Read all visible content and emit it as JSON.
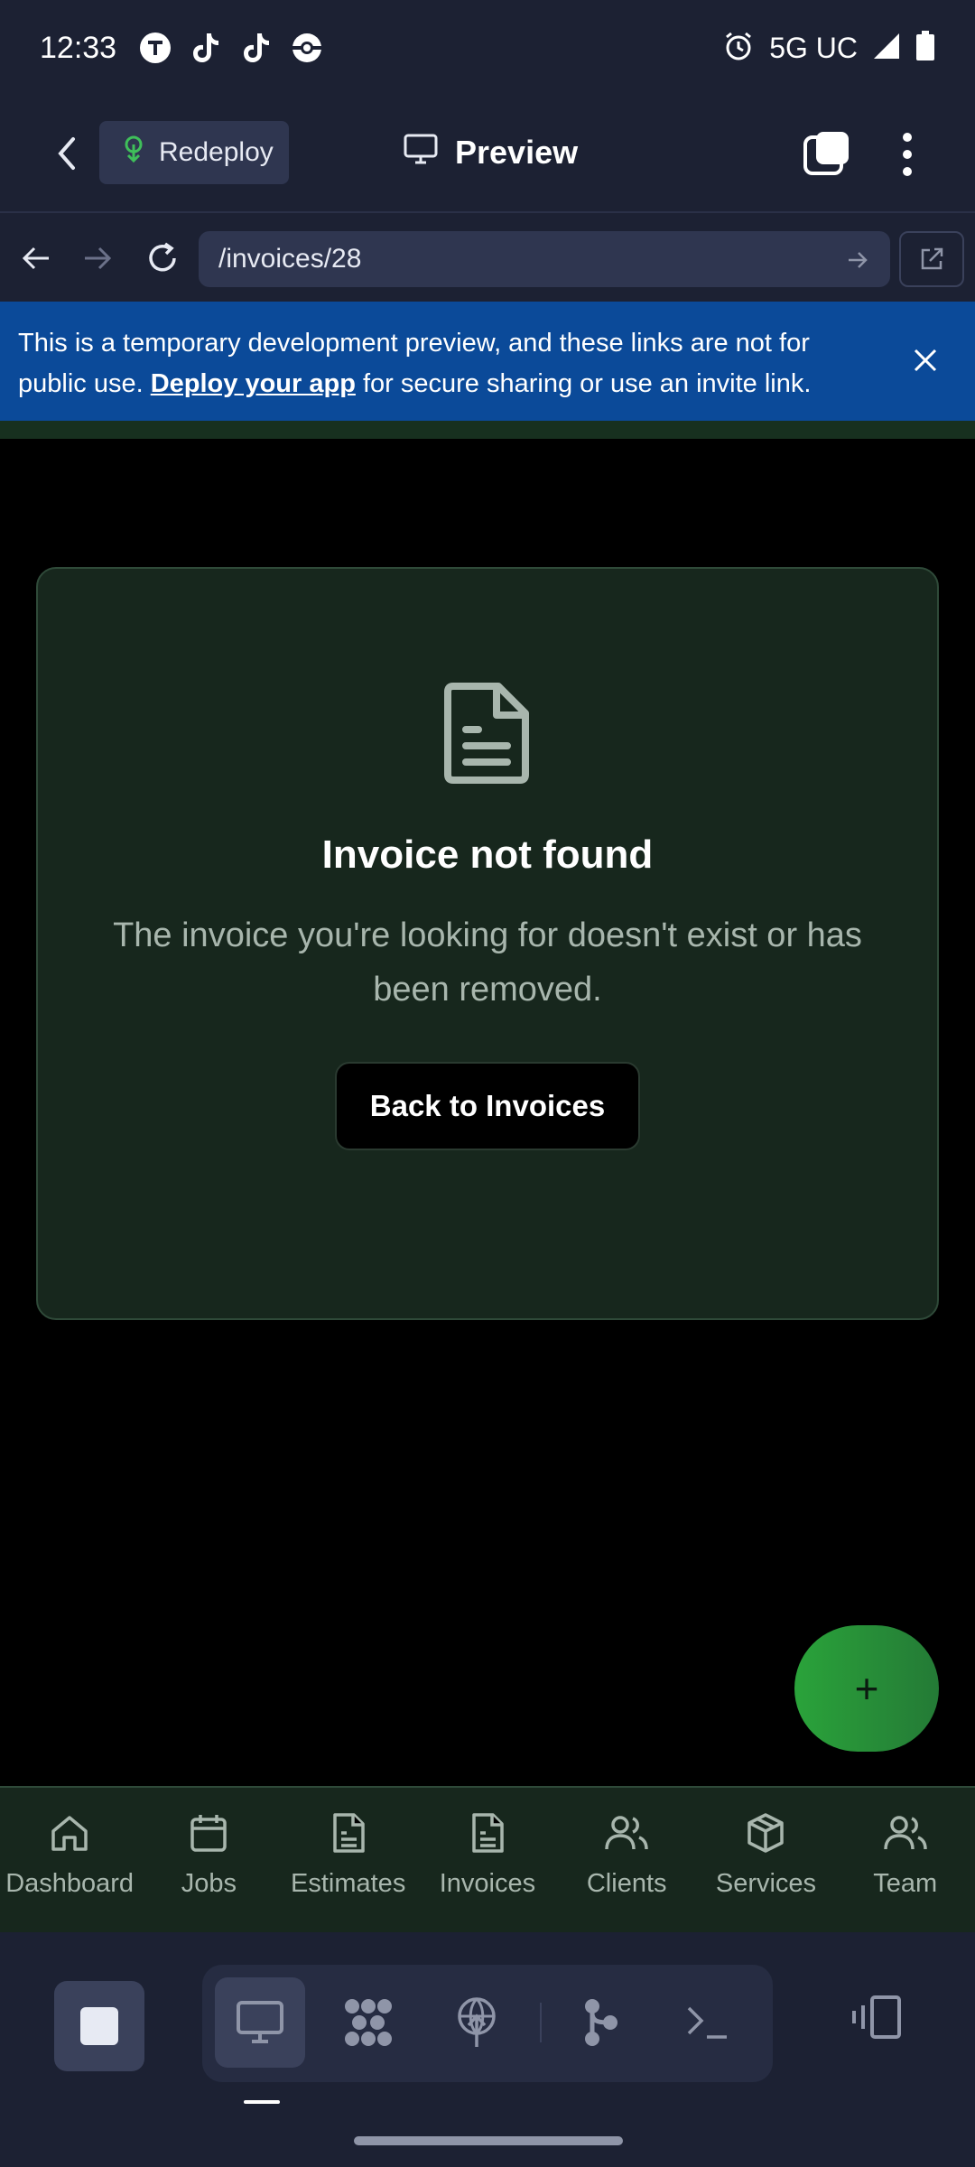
{
  "status_bar": {
    "time": "12:33",
    "network": "5G UC",
    "notification_icons": [
      "t-mobile-icon",
      "tiktok-icon",
      "tiktok-icon",
      "pokeball-icon"
    ]
  },
  "app_bar": {
    "redeploy_label": "Redeploy",
    "title": "Preview"
  },
  "url_bar": {
    "url": "/invoices/28"
  },
  "banner": {
    "text_before": "This is a temporary development preview, and these links are not for public use. ",
    "link_text": "Deploy your app",
    "text_after": " for secure sharing or use an invite link."
  },
  "empty_state": {
    "title": "Invoice not found",
    "message": "The invoice you're looking for doesn't exist or has been removed.",
    "button_label": "Back to Invoices"
  },
  "fab": {
    "label": "+"
  },
  "bottom_nav": {
    "items": [
      {
        "label": "Dashboard",
        "icon": "home-icon"
      },
      {
        "label": "Jobs",
        "icon": "calendar-icon"
      },
      {
        "label": "Estimates",
        "icon": "document-icon"
      },
      {
        "label": "Invoices",
        "icon": "document-icon"
      },
      {
        "label": "Clients",
        "icon": "users-icon"
      },
      {
        "label": "Services",
        "icon": "package-icon"
      },
      {
        "label": "Team",
        "icon": "users-icon"
      }
    ]
  },
  "colors": {
    "chrome_bg": "#1c2133",
    "banner_bg": "#0b4a99",
    "card_bg": "#17271d",
    "fab_green": "#2aa33a",
    "muted_text": "#a8b6ad"
  }
}
